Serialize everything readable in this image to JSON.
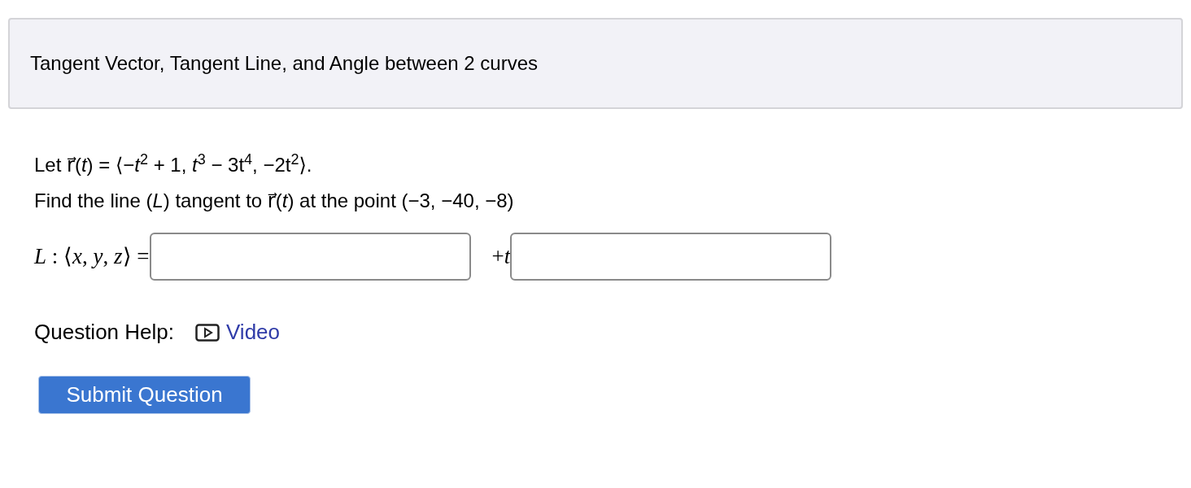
{
  "header": {
    "title": "Tangent Vector, Tangent Line, and Angle between 2 curves"
  },
  "problem": {
    "lines": [
      "Let r⃗(*t*) = ⟨−*t*$^{2}$ + 1, *t*$^{3}$ − 3t$^{4}$, −2t$^{2}$⟩.",
      "Find the line (*L*) tangent to r⃗(*t*) at the point (−3, −40, −8)"
    ]
  },
  "answer": {
    "label": "*L* : ⟨*x*, *y*, *z*⟩ =",
    "between": "+*t*"
  },
  "help": {
    "label": "Question Help:",
    "link": "Video"
  },
  "submit": "Submit Question"
}
